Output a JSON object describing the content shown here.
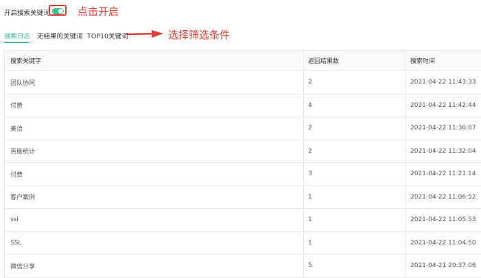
{
  "toggle": {
    "label": "开启搜索关键词",
    "enabled": true
  },
  "annotations": {
    "enable_hint": "点击开启",
    "filter_hint": "选择筛选条件"
  },
  "tabs": [
    {
      "label": "搜索日志",
      "active": true
    },
    {
      "label": "无结果的关键词",
      "active": false
    },
    {
      "label": "TOP10关键词",
      "active": false
    }
  ],
  "table": {
    "headers": [
      "搜索关键字",
      "返回结果数",
      "搜索时间"
    ],
    "rows": [
      [
        "团队协同",
        "2",
        "2021-04-22 11:43:33"
      ],
      [
        "付费",
        "4",
        "2021-04-22 11:42:44"
      ],
      [
        "美洽",
        "2",
        "2021-04-22 11:36:07"
      ],
      [
        "百度统计",
        "2",
        "2021-04-22 11:32:04"
      ],
      [
        "付费",
        "3",
        "2021-04-22 11:21:14"
      ],
      [
        "客户案例",
        "1",
        "2021-04-22 11:06:52"
      ],
      [
        "ssl",
        "1",
        "2021-04-22 11:05:53"
      ],
      [
        "SSL",
        "1",
        "2021-04-22 11:04:50"
      ],
      [
        "微信分享",
        "5",
        "2021-04-21 20:37:06"
      ]
    ]
  },
  "colors": {
    "accent": "#3cbf93",
    "annotation": "#e23a2e",
    "border": "#e8e8e8"
  }
}
